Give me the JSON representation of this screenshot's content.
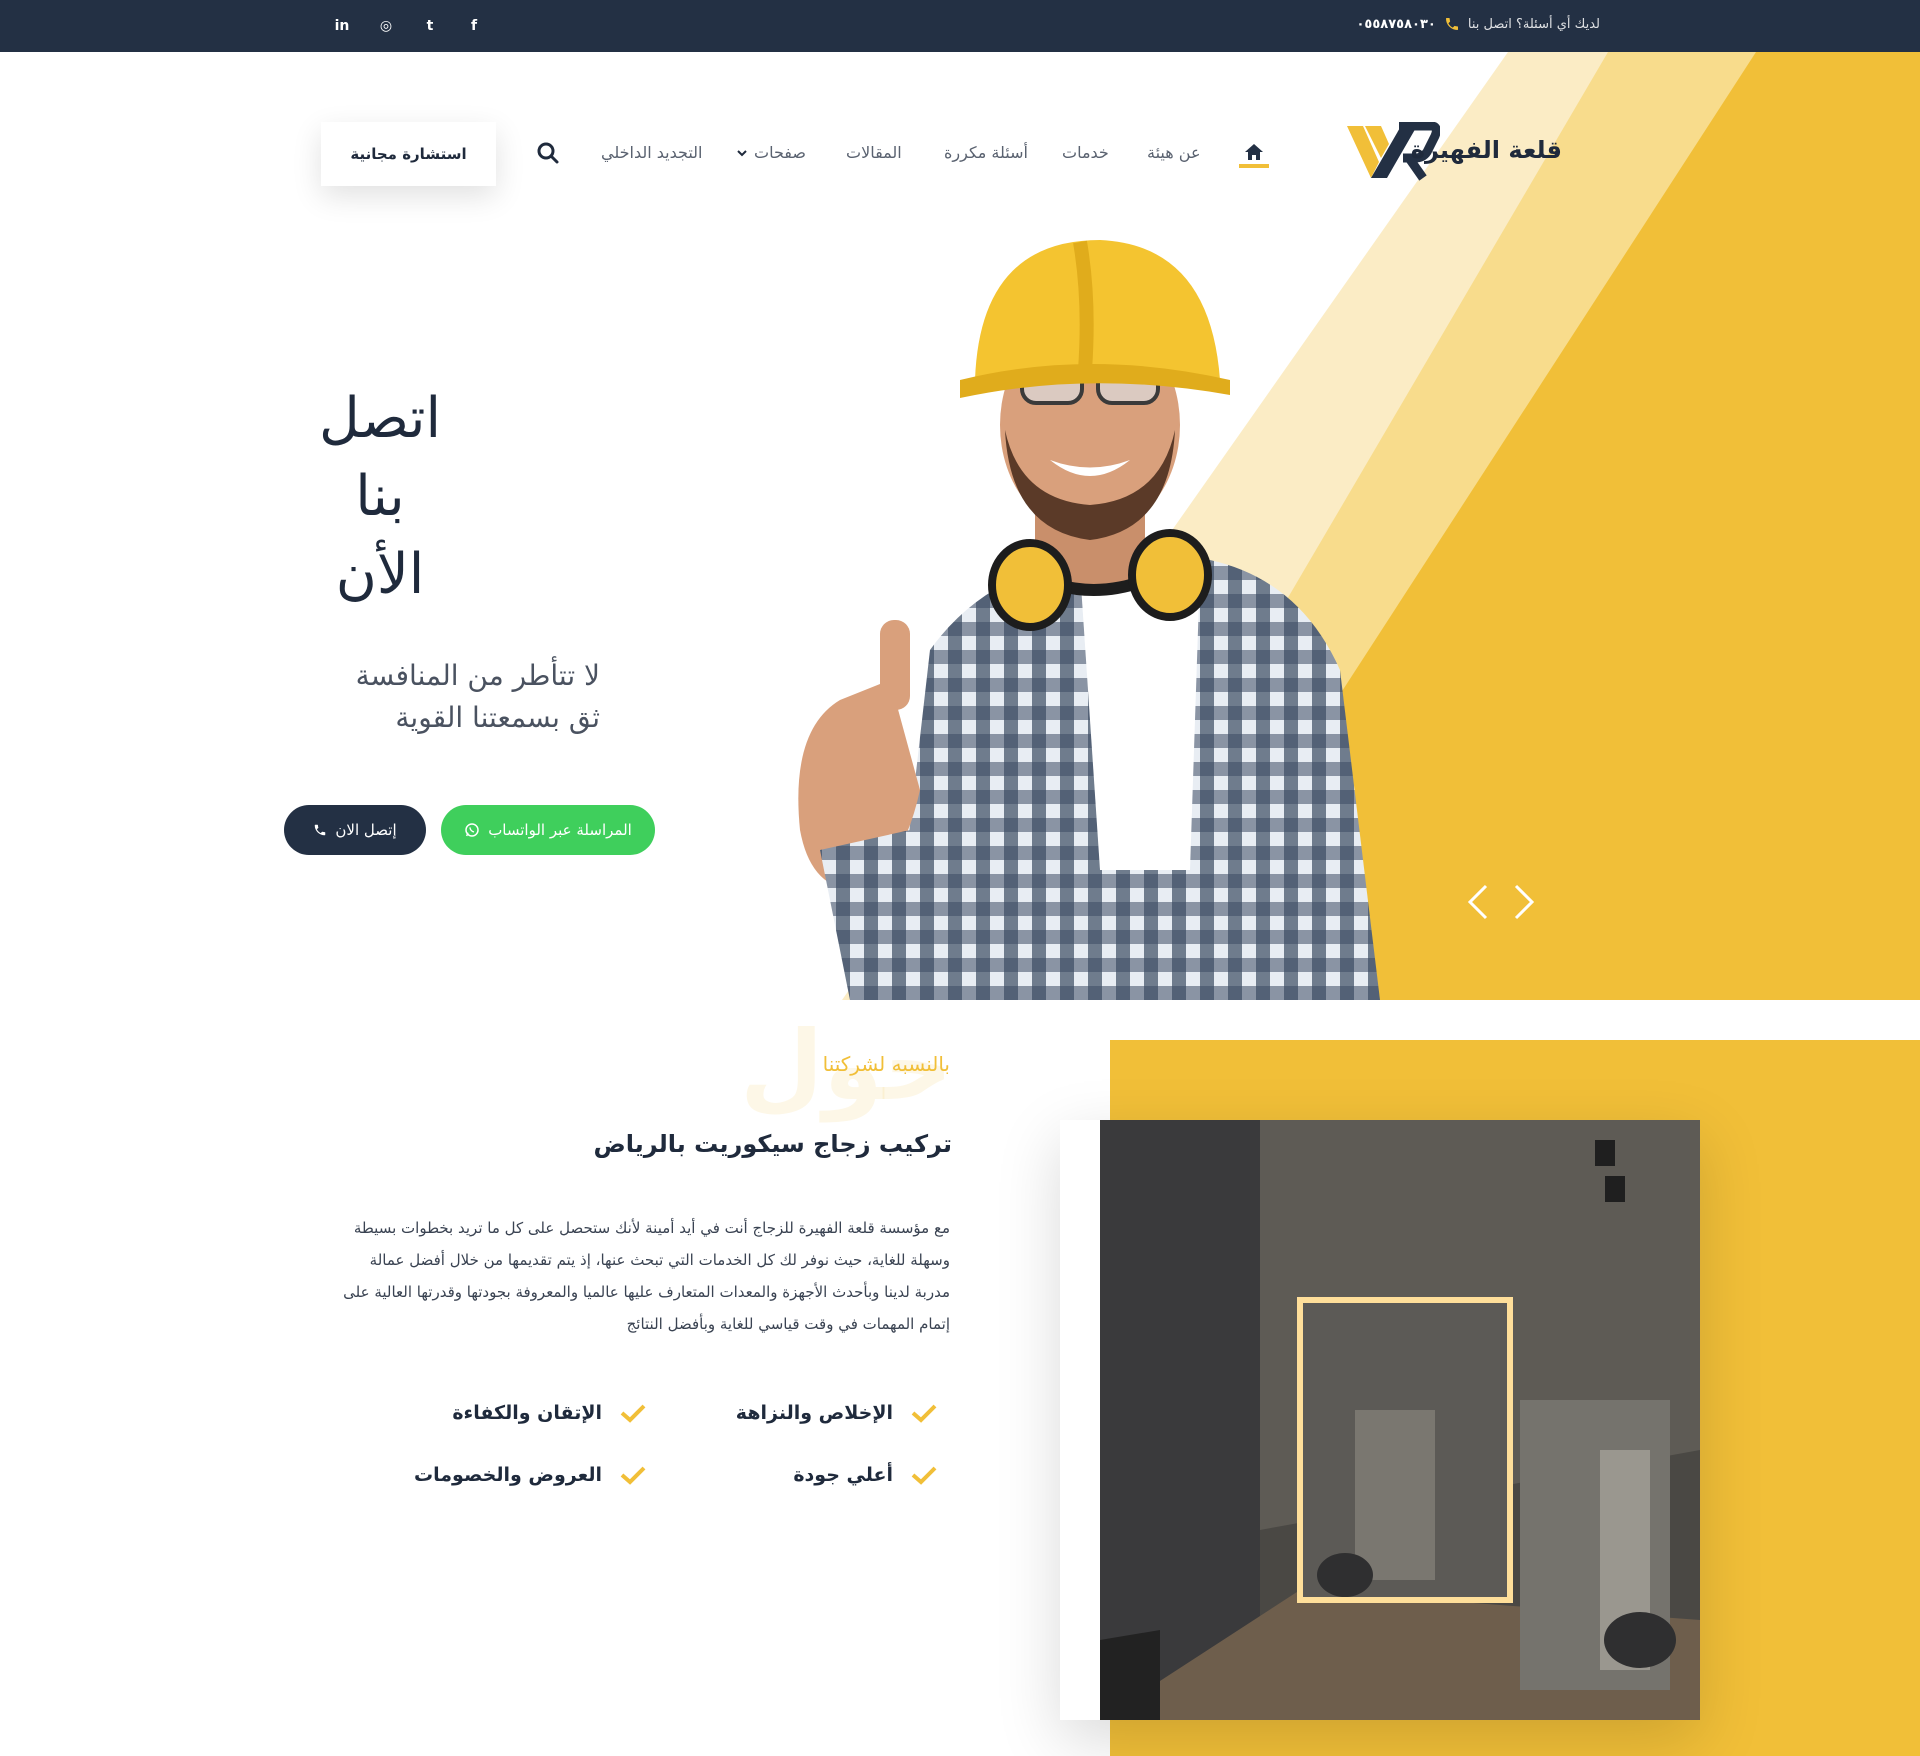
{
  "topbar": {
    "contact_question": "لديك أي أسئلة؟ اتصل بنا",
    "phone": "٠٥٥٨٧٥٨٠٣٠",
    "social": [
      {
        "icon": "linkedin-icon",
        "glyph": "in"
      },
      {
        "icon": "instagram-icon",
        "glyph": "◎"
      },
      {
        "icon": "twitter-icon",
        "glyph": "t"
      },
      {
        "icon": "facebook-icon",
        "glyph": "f"
      }
    ]
  },
  "brand": {
    "name": "قلعة الفهيرة",
    "accent": "#f1bf38",
    "navy": "#233044"
  },
  "nav": {
    "items": [
      {
        "label": "عن هيئة"
      },
      {
        "label": "خدمات"
      },
      {
        "label": "أسئلة مكررة"
      },
      {
        "label": "المقالات"
      },
      {
        "label": "صفحات"
      },
      {
        "label": "التجديد الداخلي"
      }
    ],
    "consult_button": "استشارة مجانية"
  },
  "hero": {
    "title_line1": "اتصل",
    "title_line2": "بنا",
    "title_line3": "الأن",
    "sub_line1": "لا تتأطر من المنافسة",
    "sub_line2": "ثق بسمعتنا القوية",
    "call_button": "إتصل الان",
    "whatsapp_button": "المراسلة عبر الواتساب"
  },
  "about": {
    "eyebrow": "بالنسبه لشركتنا",
    "watermark": "حول",
    "title": "تركيب زجاج سيكوريت بالرياض",
    "body": "مع مؤسسة قلعة الفهيرة للزجاج أنت في أيد أمينة لأنك ستحصل على كل ما تريد بخطوات بسيطة وسهلة للغاية، حيث نوفر لك كل الخدمات التي تبحث عنها، إذ يتم تقديمها من خلال أفضل عمالة مدربة لدينا وبأحدث الأجهزة والمعدات المتعارف عليها عالميا والمعروفة بجودتها وقدرتها العالية على إتمام المهمات في وقت قياسي للغاية وبأفضل النتائج",
    "features": [
      {
        "label": "الإخلاص والنزاهة"
      },
      {
        "label": "الإتقان والكفاءة"
      },
      {
        "label": "أعلي جودة"
      },
      {
        "label": "العروض والخصومات"
      }
    ]
  }
}
